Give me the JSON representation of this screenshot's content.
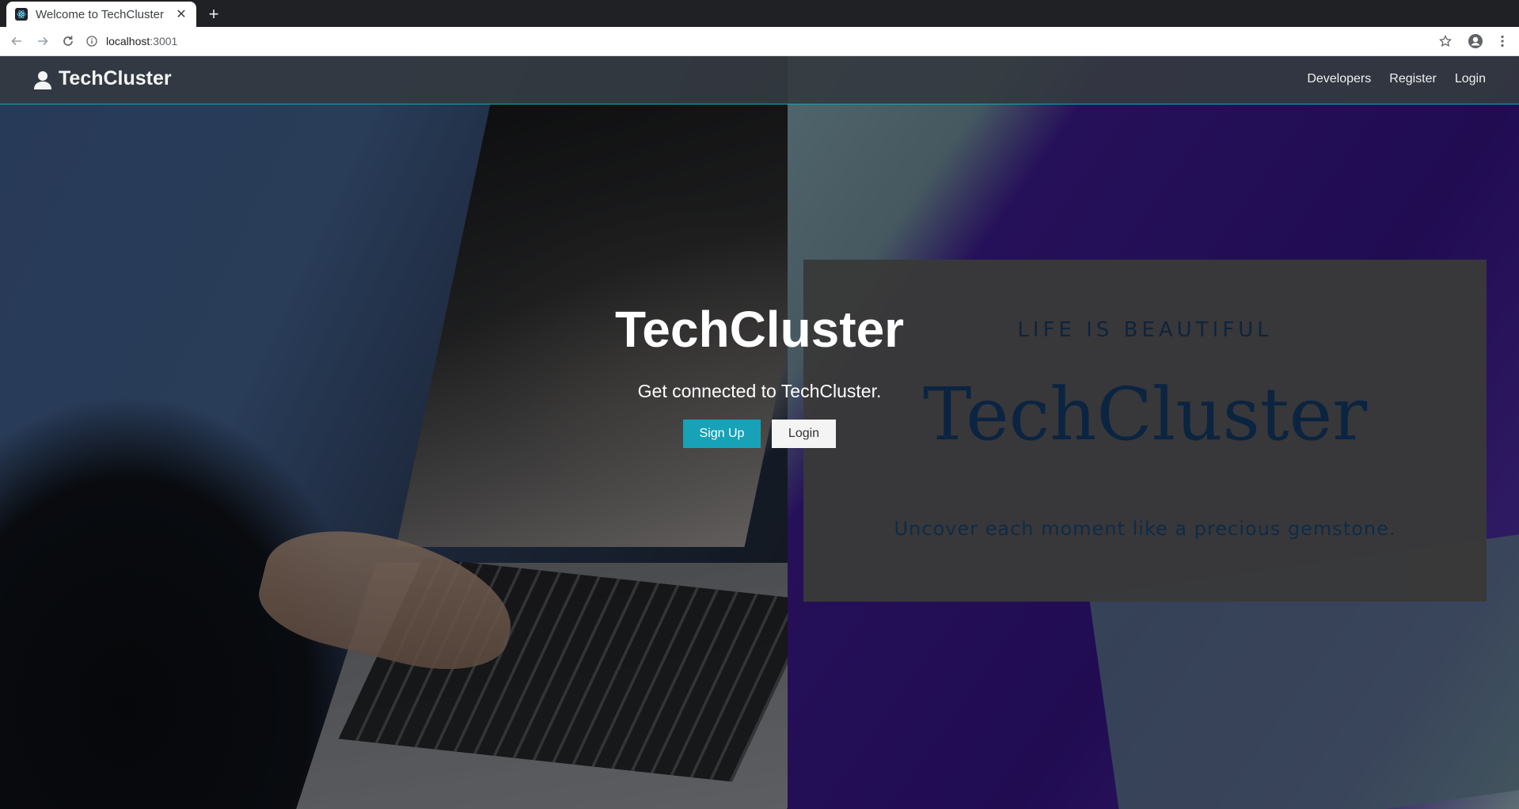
{
  "browser": {
    "tab_title": "Welcome to TechCluster",
    "url_host": "localhost",
    "url_port": ":3001"
  },
  "navbar": {
    "brand": "TechCluster",
    "links": [
      "Developers",
      "Register",
      "Login"
    ]
  },
  "hero": {
    "title": "TechCluster",
    "subtitle": "Get connected to TechCluster.",
    "primary_button": "Sign Up",
    "secondary_button": "Login"
  },
  "promo_card": {
    "kicker": "LIFE IS BEAUTIFUL",
    "title": "TechCluster",
    "tagline": "Uncover each moment like a precious gemstone."
  },
  "colors": {
    "accent": "#17a2b8",
    "navbar": "#343a40"
  }
}
